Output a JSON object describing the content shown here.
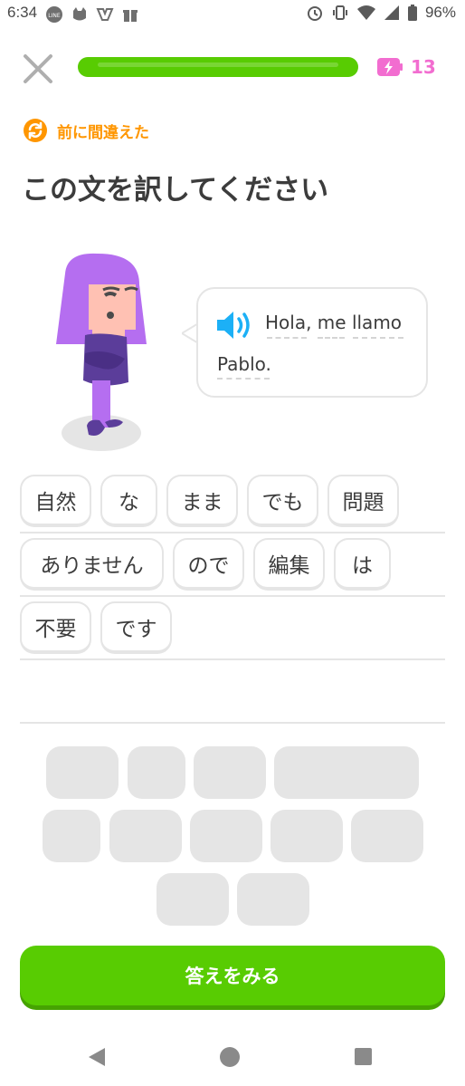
{
  "status_bar": {
    "time": "6:34",
    "battery": "96%",
    "left_icons": [
      "line-icon",
      "cat-icon",
      "game-icon",
      "gift-icon"
    ],
    "right_icons": [
      "alarm-icon",
      "vibrate-icon",
      "wifi-icon",
      "signal-icon",
      "battery-icon"
    ]
  },
  "top_bar": {
    "progress": 1.0,
    "energy_count": "13",
    "colors": {
      "progress": "#58cc02",
      "energy": "#f26dd0"
    }
  },
  "lesson": {
    "mistake_label": "前に間違えた",
    "title": "この文を訳してください",
    "prompt_line1": "Hola, me llamo",
    "prompt_line2": "Pablo."
  },
  "answer_chips": [
    {
      "label": "自然"
    },
    {
      "label": "な"
    },
    {
      "label": "まま"
    },
    {
      "label": "でも"
    },
    {
      "label": "問題"
    },
    {
      "label": "ありません"
    },
    {
      "label": "ので"
    },
    {
      "label": "編集"
    },
    {
      "label": "は"
    },
    {
      "label": "不要"
    },
    {
      "label": "です"
    }
  ],
  "word_bank_slots": 11,
  "check_button": {
    "label": "答えをみる",
    "color": "#58cc02"
  },
  "nav": {
    "back": "back-icon",
    "home": "home-icon",
    "recents": "recents-icon"
  }
}
